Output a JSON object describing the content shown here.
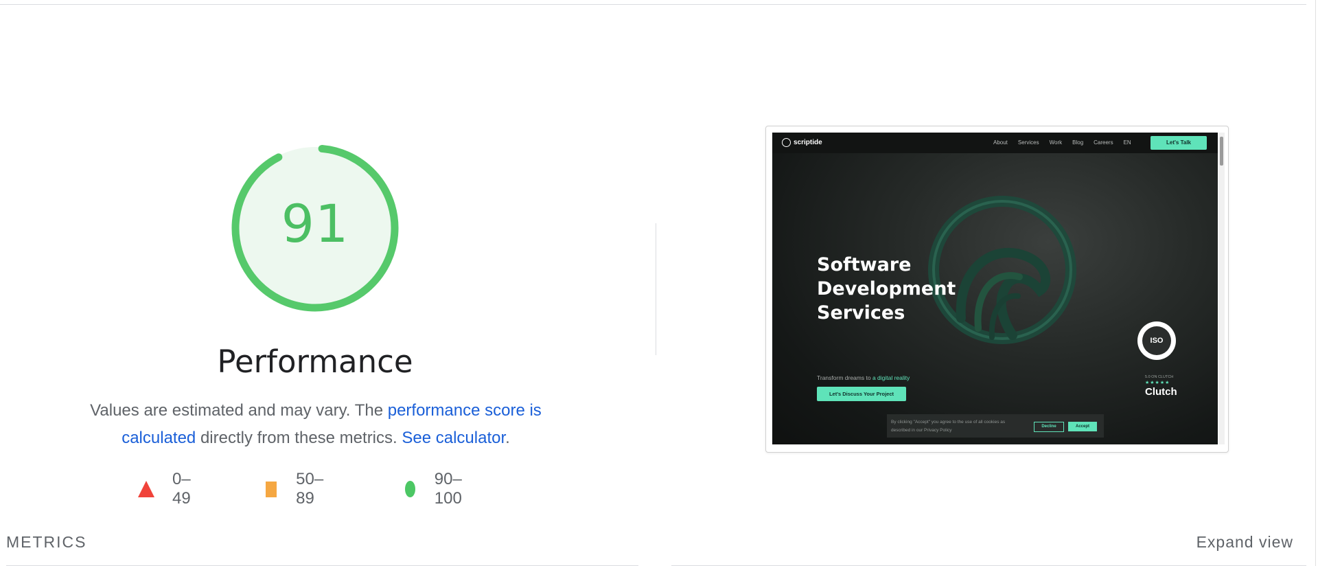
{
  "score": {
    "value": "91",
    "fraction": 0.91,
    "color": "#4cbf63",
    "category": "Performance"
  },
  "description": {
    "text_before": "Values are estimated and may vary. The ",
    "link_score": "performance score is calculated",
    "text_middle": " directly from these metrics. ",
    "link_calculator": "See calculator",
    "text_after": "."
  },
  "legend": [
    {
      "shape": "triangle",
      "range": "0–49",
      "color": "#f0433a"
    },
    {
      "shape": "square",
      "range": "50–89",
      "color": "#f5a742"
    },
    {
      "shape": "circle",
      "range": "90–100",
      "color": "#4cc764"
    }
  ],
  "thumbnail": {
    "brand": "scriptide",
    "nav_links": [
      "About",
      "Services",
      "Work",
      "Blog",
      "Careers",
      "EN"
    ],
    "nav_cta": "Let's Talk",
    "hero_lines": [
      "Software",
      "Development",
      "Services"
    ],
    "tagline_before": "Transform dreams to ",
    "tagline_highlight": "a digital reality",
    "hero_button": "Let's Discuss Your Project",
    "iso_label": "ISO",
    "clutch_small": "5.0 ON CLUTCH",
    "clutch_stars": "★★★★★",
    "clutch": "Clutch",
    "cookie_text": "By clicking \"Accept\" you agree to the use of all cookies as described in our Privacy Policy",
    "cookie_decline": "Decline",
    "cookie_accept": "Accept",
    "accent_color": "#5fe3b9"
  },
  "metrics": {
    "title": "METRICS",
    "expand_label": "Expand view"
  }
}
